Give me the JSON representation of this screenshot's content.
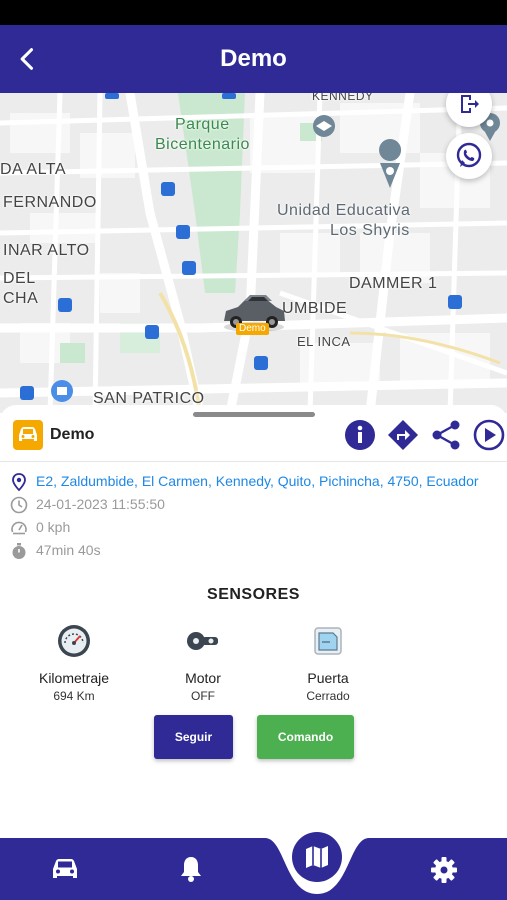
{
  "app": {
    "title": "Demo"
  },
  "map": {
    "labels": {
      "kennedy": "KENNEDY",
      "parque": "Parque",
      "bicentenario": "Bicentenario",
      "da_alta": "DA ALTA",
      "fernando": "FERNANDO",
      "inar_alto": "INAR ALTO",
      "del": "DEL",
      "cha": "CHA",
      "unidad1": "Unidad Educativa",
      "unidad2": "Los Shyris",
      "dammer": "DAMMER 1",
      "umbide": "UMBIDE",
      "el_inca": "EL INCA",
      "san_patrico": "SAN PATRICO"
    },
    "marker_label": "Demo"
  },
  "unit": {
    "name": "Demo",
    "address": "E2, Zaldumbide, El Carmen, Kennedy, Quito, Pichincha, 4750, Ecuador",
    "datetime": "24-01-2023 11:55:50",
    "speed": "0 kph",
    "duration": "47min 40s"
  },
  "sensors": {
    "title": "SENSORES",
    "items": [
      {
        "name": "Kilometraje",
        "value": "694 Km",
        "icon": "odometer-icon"
      },
      {
        "name": "Motor",
        "value": "OFF",
        "icon": "engine-key-icon"
      },
      {
        "name": "Puerta",
        "value": "Cerrado",
        "icon": "door-icon"
      }
    ]
  },
  "buttons": {
    "seguir": "Seguir",
    "comando": "Comando"
  },
  "colors": {
    "primary": "#2f2a96",
    "accent": "#f5a800",
    "green": "#4caf50",
    "link": "#1e88e5"
  }
}
